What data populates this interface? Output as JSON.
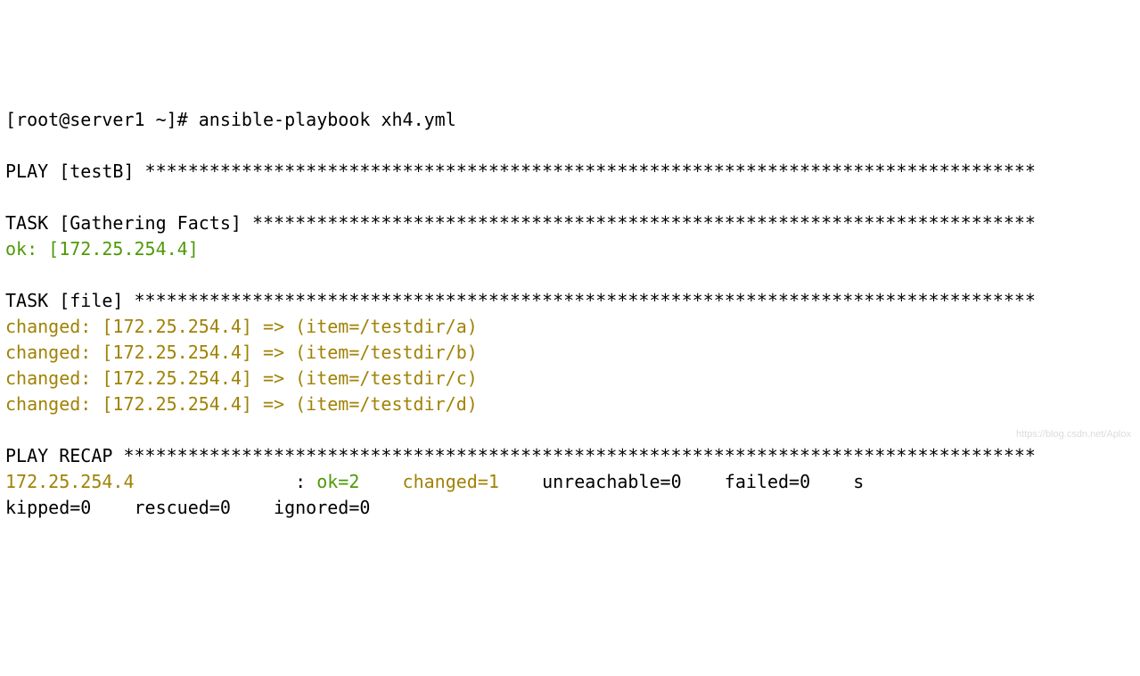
{
  "prompt": "[root@server1 ~]# ",
  "command": "ansible-playbook xh4.yml",
  "play_header": "PLAY [testB] ***********************************************************************************",
  "task_gather_header": "TASK [Gathering Facts] *************************************************************************",
  "gather_ok": "ok: [172.25.254.4]",
  "task_file_header": "TASK [file] ************************************************************************************",
  "changed_a": "changed: [172.25.254.4] => (item=/testdir/a)",
  "changed_b": "changed: [172.25.254.4] => (item=/testdir/b)",
  "changed_c": "changed: [172.25.254.4] => (item=/testdir/c)",
  "changed_d": "changed: [172.25.254.4] => (item=/testdir/d)",
  "recap_header": "PLAY RECAP *************************************************************************************",
  "recap_host": "172.25.254.4               ",
  "recap_colon": ": ",
  "recap_ok": "ok=2   ",
  "recap_changed": " changed=1   ",
  "recap_unreachable": " unreachable=0   ",
  "recap_failed": " failed=0   ",
  "recap_s": " s",
  "recap_line2": "kipped=0    rescued=0    ignored=0",
  "watermark": "https://blog.csdn.net/Aplox"
}
